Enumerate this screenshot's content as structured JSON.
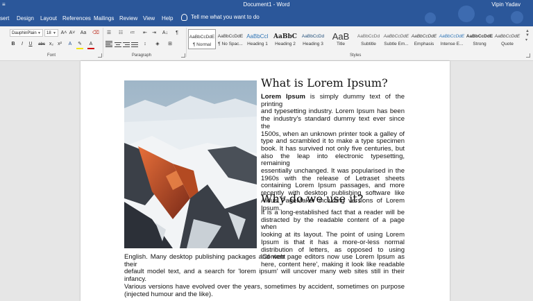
{
  "titlebar": {
    "quick_access": "≡",
    "doc_title": "Document1 - Word",
    "user": "Vipin Yadav"
  },
  "tabs": [
    "sert",
    "Design",
    "Layout",
    "References",
    "Mailings",
    "Review",
    "View",
    "Help"
  ],
  "tell_me": "Tell me what you want to do",
  "font_group": {
    "font_name": "DauphinPlain",
    "font_size": "18",
    "label": "Font",
    "grow": "A˄",
    "shrink": "A˅",
    "case": "Aa",
    "bold": "B",
    "italic": "I",
    "underline": "U",
    "strike": "abc",
    "subscript": "x₂",
    "superscript": "x²",
    "font_color": "A"
  },
  "paragraph_group": {
    "label": "Paragraph",
    "pilcrow": "¶",
    "sort": "A↓"
  },
  "styles_group": {
    "label": "Styles",
    "styles": [
      {
        "preview": "AaBbCcDdE",
        "name": "¶ Normal"
      },
      {
        "preview": "AaBbCcDdE",
        "name": "¶ No Spac..."
      },
      {
        "preview": "AaBbCcI",
        "name": "Heading 1"
      },
      {
        "preview": "AaBbC",
        "name": "Heading 2"
      },
      {
        "preview": "AaBbCcDd",
        "name": "Heading 3"
      },
      {
        "preview": "AaB",
        "name": "Title"
      },
      {
        "preview": "AaBbCcDd",
        "name": "Subtitle"
      },
      {
        "preview": "AaBbCcDdE",
        "name": "Subtle Em..."
      },
      {
        "preview": "AaBbCcDdE",
        "name": "Emphasis"
      },
      {
        "preview": "AaBbCcDdE",
        "name": "Intense E..."
      },
      {
        "preview": "AaBbCcDdE",
        "name": "Strong"
      },
      {
        "preview": "AaBbCcDdE",
        "name": "Quote"
      }
    ]
  },
  "document": {
    "heading1": "What is Lorem Ipsum?",
    "para1_lead": "Lorem Ipsum",
    "para1_lines": [
      " is simply dummy text of the printing",
      "and typesetting industry. Lorem Ipsum has been",
      "the industry's standard dummy text ever since the",
      "1500s, when an unknown printer took a galley of",
      "type and scrambled it to make a type specimen",
      "book. It has survived not only five centuries, but",
      "also the leap into electronic typesetting, remaining",
      "essentially unchanged. It was popularised in the",
      "1960s with the release of Letraset sheets",
      "containing Lorem Ipsum passages, and more",
      "recently with desktop publishing software like",
      "Aldus PageMaker including versions of Lorem",
      "Ipsum."
    ],
    "heading2": "Why do we use it?",
    "para2_lines": [
      "It is a long-established fact that a reader will be",
      "distracted by the readable content of a page when",
      "looking at its layout. The point of using Lorem",
      "Ipsum is that it has a more-or-less normal",
      "distribution of letters, as opposed to using 'Content",
      "here, content here', making it look like readable"
    ],
    "para2_wide_lines": [
      "English. Many desktop publishing packages and web page editors now use Lorem Ipsum as their",
      "default model text, and a search for 'lorem ipsum' will uncover many web sites still in their infancy.",
      "Various versions have evolved over the years, sometimes by accident, sometimes on purpose",
      "(injected humour and the like)."
    ]
  },
  "colors": {
    "word_blue": "#2b579a",
    "ribbon_bg": "#f3f3f3",
    "canvas": "#e6e6e6"
  }
}
